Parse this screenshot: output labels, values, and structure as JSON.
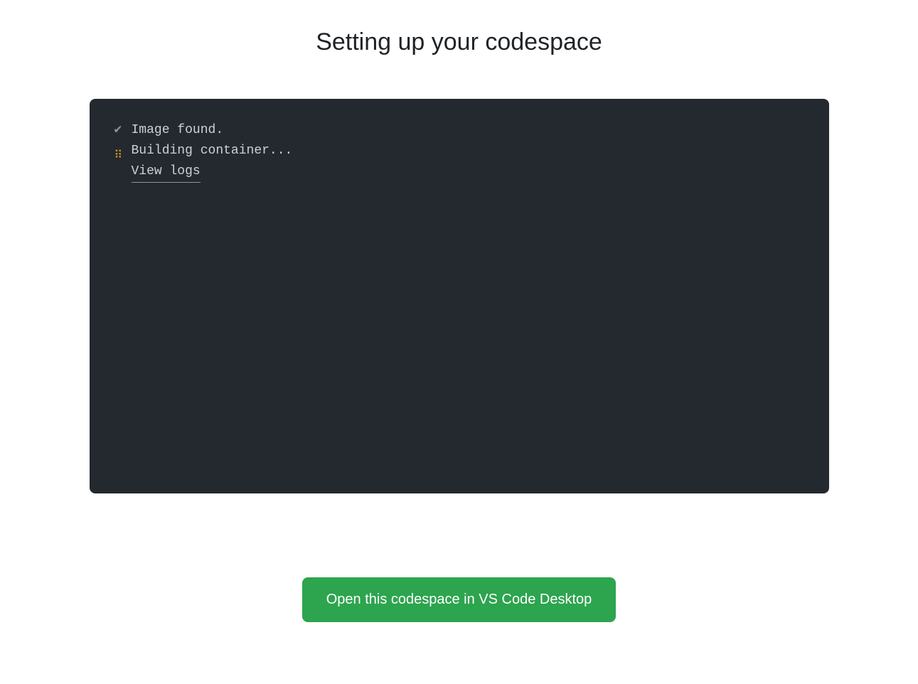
{
  "title": "Setting up your codespace",
  "terminal": {
    "lines": [
      {
        "icon": "checkmark",
        "text": "Image found."
      },
      {
        "icon": "spinner",
        "text": "Building container..."
      }
    ],
    "view_logs_label": "View logs"
  },
  "button": {
    "open_vscode_label": "Open this codespace in VS Code Desktop"
  }
}
